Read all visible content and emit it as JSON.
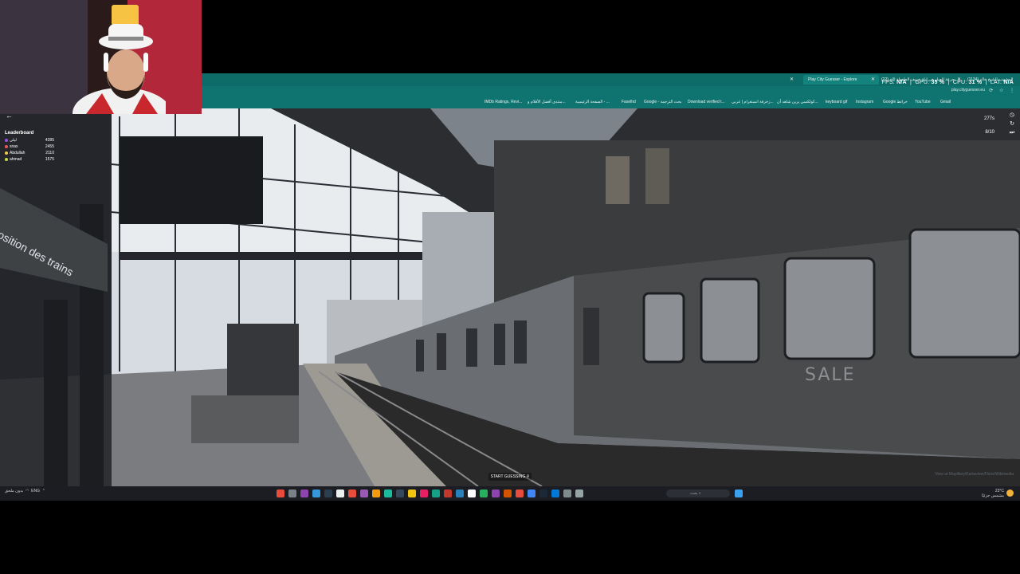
{
  "colors": {
    "chrome_teal": "#0f7470",
    "tab_strip": "#0d6c68",
    "taskbar": "#1b1d22",
    "leaderboard_gold": "#f2c94c",
    "leaderboard_purple": "#9b51e0",
    "leaderboard_red": "#eb5757",
    "leaderboard_yellowgreen": "#c7d94a"
  },
  "browser": {
    "tabs": [
      {
        "label": "Play City Guesser - Explore",
        "active": true
      },
      {
        "label": "(22) كل جرعة الجيل هي ليلة خريف الطفولة الله...",
        "active": false
      },
      {
        "label": "(1134) سيرة المشهد - الشيخ خالد...",
        "active": false
      }
    ],
    "url": "play.cityguesser.eu",
    "bookmarks": [
      "IMDb Ratings, Revi...",
      "منتدى أفضل الأفلام و...",
      "الصفحة الرئيسية - ...",
      "Faselhd",
      "Google - بحث الترجمة",
      "Download verified t...",
      "زخرفة انستغرام | عربي...",
      "كولكسي يرين شاهد أن...",
      "keyboard gif",
      "Instagram",
      "Google خرائط",
      "YouTube",
      "Gmail"
    ]
  },
  "stats": {
    "fps_label": "FPS:",
    "fps_value": "N/A",
    "gpu_label": "GPU:",
    "gpu_value": "35 %",
    "cpu_label": "CPU:",
    "cpu_value": "31 %",
    "lat_label": "LAT:",
    "lat_value": "N/A"
  },
  "game": {
    "leaderboard_title": "Leaderboard",
    "leaderboard": [
      {
        "name": "ليلى",
        "score": "4285"
      },
      {
        "name": "snax",
        "score": "2455"
      },
      {
        "name": "Abdullah",
        "score": "2110"
      },
      {
        "name": "ahmad",
        "score": "1575"
      }
    ],
    "timer": "277s",
    "round": "8/10",
    "start_label": "START GUESSING",
    "attribution": "View at Mapillary/Kartaview/Flickr/Wikimedia"
  },
  "taskbar": {
    "left_text": "بدون ملحق",
    "lang": "ENG",
    "search_placeholder": "بحث",
    "temperature": "23°C",
    "weather": "مشمس جزئيًا",
    "clock": "9:16"
  },
  "scene": {
    "sign_text": "osition des trains",
    "graffiti": "SALE"
  }
}
